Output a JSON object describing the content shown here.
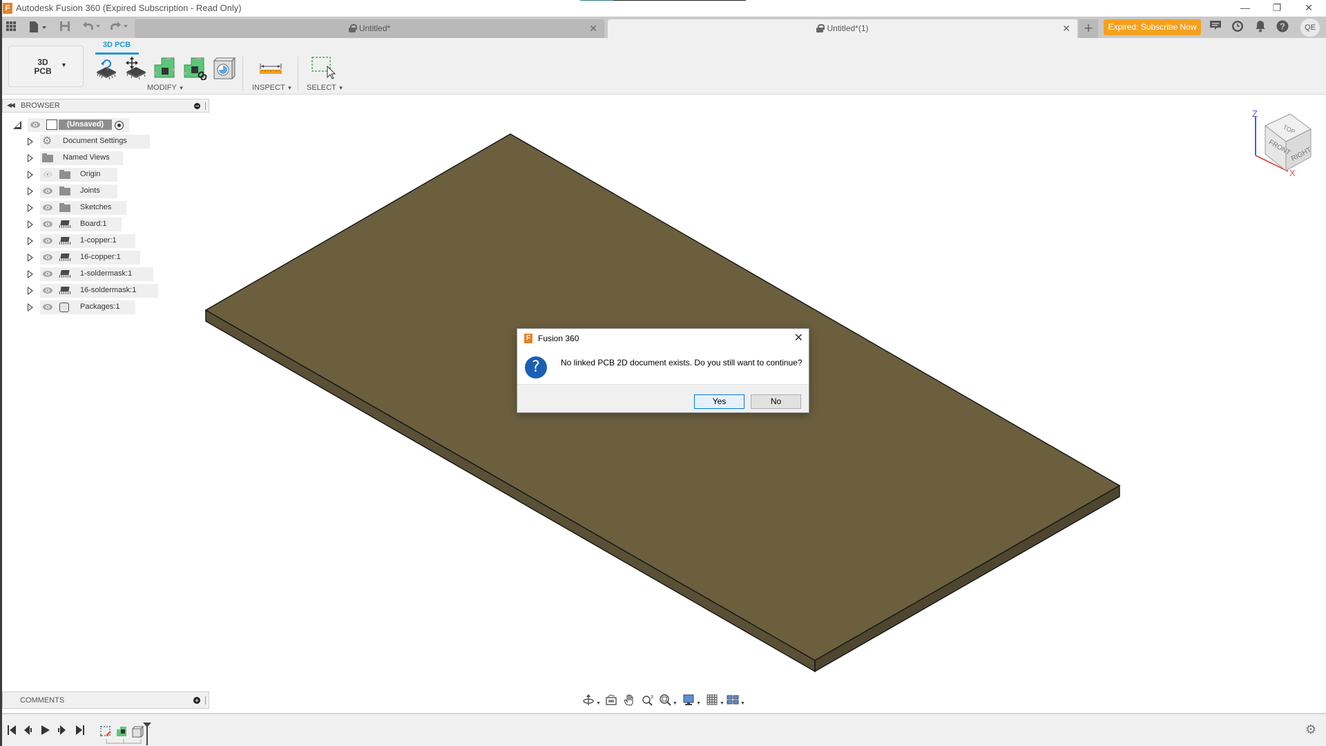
{
  "window": {
    "title": "Autodesk Fusion 360 (Expired Subscription - Read Only)",
    "app_icon": "F",
    "progress": 0.2,
    "controls": {
      "minimize": "—",
      "restore": "❐",
      "close": "✕"
    }
  },
  "quick_access": {
    "icons": [
      "data-panel-grid-icon",
      "file-icon",
      "save-icon",
      "undo-icon",
      "redo-icon"
    ]
  },
  "tabs": [
    {
      "label": "Untitled*",
      "active": false,
      "locked": true
    },
    {
      "label": "Untitled*(1)",
      "active": true,
      "locked": true
    }
  ],
  "header": {
    "new_tab": "+",
    "subscribe_label": "Expired: Subscribe Now",
    "subscribe_color": "#f5a01e",
    "avatar_initials": "QE",
    "icons": [
      "comments-icon",
      "job-status-icon",
      "notifications-icon",
      "help-icon"
    ]
  },
  "toolbar": {
    "workspace": {
      "line1": "3D",
      "line2": "PCB"
    },
    "active_tab": "3D PCB",
    "accent_color": "#1f97d4",
    "groups": [
      {
        "label": "MODIFY",
        "tools": [
          "flip-component-icon",
          "move-component-icon",
          "push-to-2d-pcb-icon",
          "link-2d-pcb-icon",
          "package-icon"
        ]
      },
      {
        "label": "INSPECT",
        "tools": [
          "measure-icon"
        ]
      },
      {
        "label": "SELECT",
        "tools": [
          "window-select-icon"
        ]
      }
    ]
  },
  "browser": {
    "title": "BROWSER",
    "root": {
      "label": "(Unsaved)"
    },
    "items": [
      {
        "label": "Document Settings",
        "icon": "gear",
        "eye": "none"
      },
      {
        "label": "Named Views",
        "icon": "folder",
        "eye": "none"
      },
      {
        "label": "Origin",
        "icon": "folder",
        "eye": "hidden"
      },
      {
        "label": "Joints",
        "icon": "folder",
        "eye": "visible"
      },
      {
        "label": "Sketches",
        "icon": "folder",
        "eye": "visible"
      },
      {
        "label": "Board:1",
        "icon": "component",
        "eye": "visible"
      },
      {
        "label": "1-copper:1",
        "icon": "component",
        "eye": "visible"
      },
      {
        "label": "16-copper:1",
        "icon": "component",
        "eye": "visible"
      },
      {
        "label": "1-soldermask:1",
        "icon": "component",
        "eye": "visible"
      },
      {
        "label": "16-soldermask:1",
        "icon": "component",
        "eye": "visible"
      },
      {
        "label": "Packages:1",
        "icon": "package",
        "eye": "visible"
      }
    ]
  },
  "comments": {
    "title": "COMMENTS"
  },
  "viewcube": {
    "top": "TOP",
    "front": "FRONT",
    "right": "RIGHT",
    "axis_z": "Z",
    "axis_x": "X"
  },
  "board": {
    "top_color": "#6b5f3e",
    "side_color": "#5a5035",
    "edge_color": "#1a1a1a"
  },
  "navbar": {
    "tools": [
      "orbit-icon",
      "look-at-icon",
      "pan-icon",
      "zoom-icon",
      "fit-icon",
      "display-settings-icon",
      "grid-icon",
      "viewports-icon"
    ]
  },
  "timeline": {
    "controls": [
      "go-to-start-icon",
      "step-back-icon",
      "play-icon",
      "step-forward-icon",
      "go-to-end-icon"
    ],
    "features": [
      "sketch-feature-icon",
      "pcb-feature-icon",
      "body-feature-icon"
    ]
  },
  "dialog": {
    "title": "Fusion 360",
    "message": "No linked PCB 2D document exists. Do you still want to continue?",
    "yes_label": "Yes",
    "no_label": "No",
    "icon": "?"
  }
}
